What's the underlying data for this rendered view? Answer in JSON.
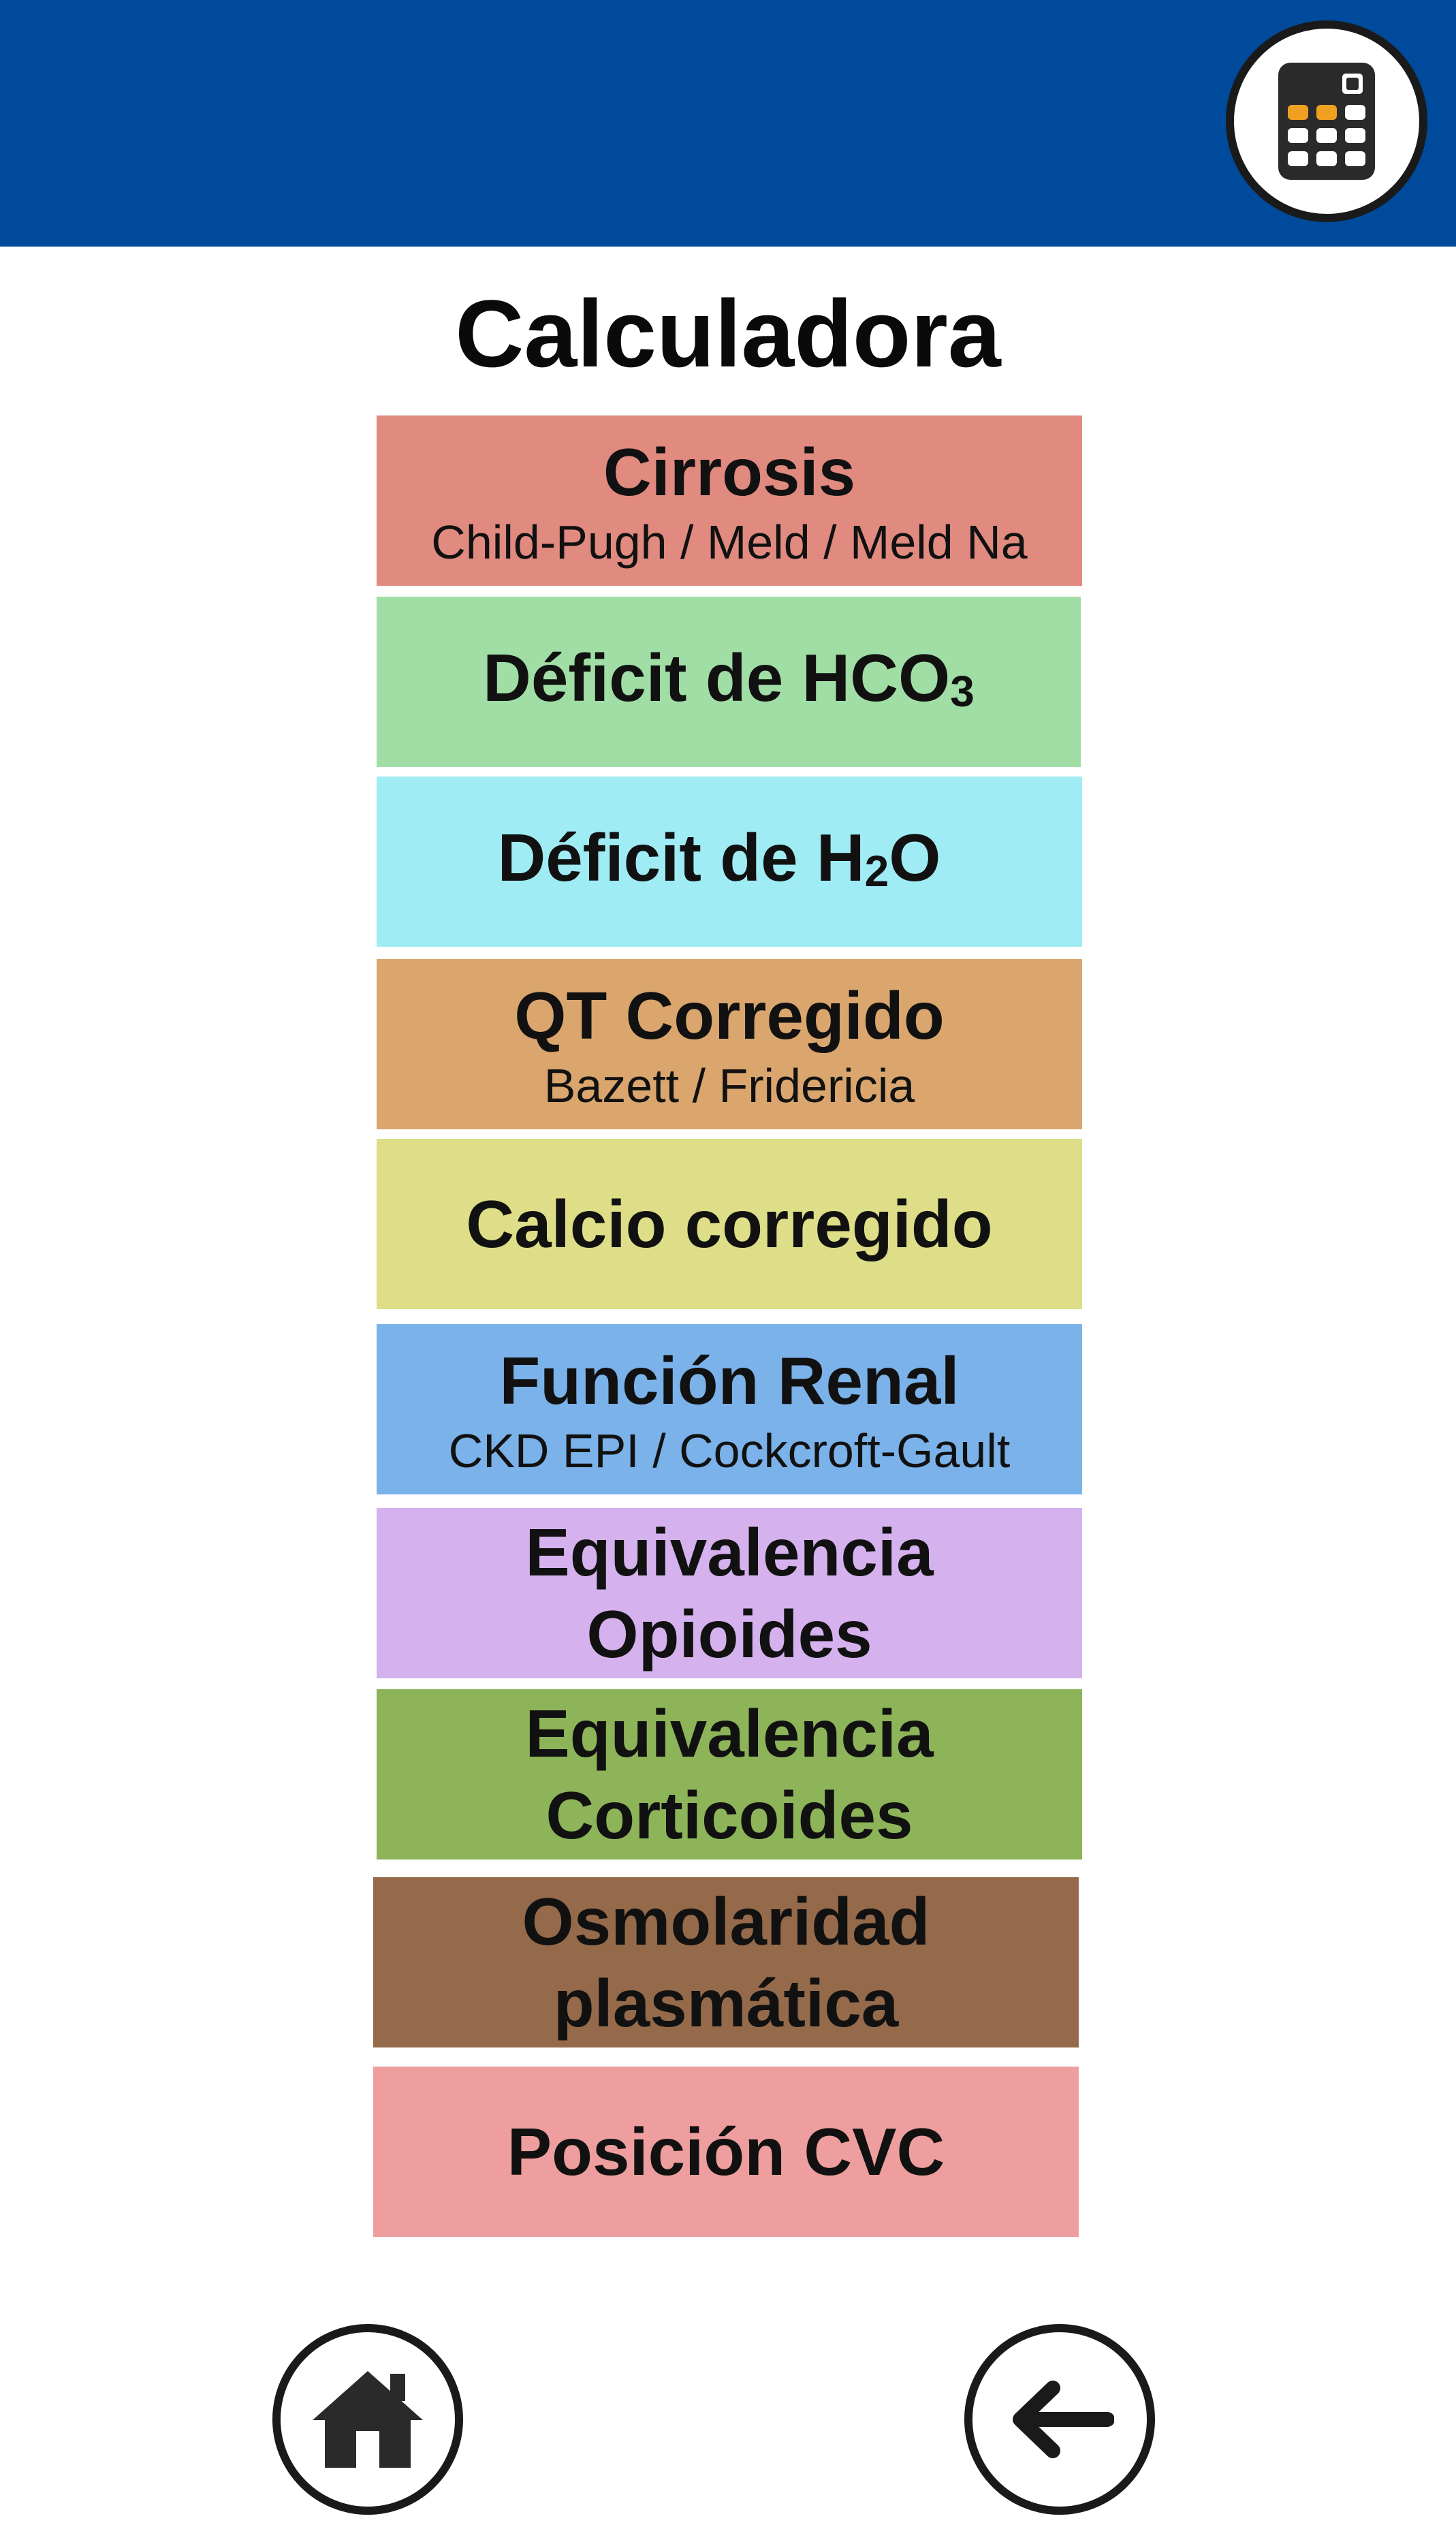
{
  "header": {
    "calculator_icon": "calculator-icon",
    "bar_color": "#004a9b"
  },
  "page": {
    "title": "Calculadora"
  },
  "menu": [
    {
      "title": "Cirrosis",
      "subtitle": "Child-Pugh / Meld / Meld Na",
      "color": "#e08a80"
    },
    {
      "title_prefix": "Déficit de HCO",
      "title_sub": "3",
      "title_suffix": "",
      "color": "#a0dea5"
    },
    {
      "title_prefix": "Déficit de H",
      "title_sub": "2",
      "title_suffix": "O",
      "color": "#a0ecf4"
    },
    {
      "title": "QT Corregido",
      "subtitle": "Bazett / Fridericia",
      "color": "#daa66e"
    },
    {
      "title": "Calcio corregido",
      "color": "#dede88"
    },
    {
      "title": "Función Renal",
      "subtitle": "CKD EPI / Cockcroft-Gault",
      "color": "#7ab2e9"
    },
    {
      "title_line1": "Equivalencia",
      "title_line2": "Opioides",
      "color": "#d5b1ed"
    },
    {
      "title_line1": "Equivalencia",
      "title_line2": "Corticoides",
      "color": "#8db458"
    },
    {
      "title_line1": "Osmolaridad",
      "title_line2": "plasmática",
      "color": "#946a4a"
    },
    {
      "title": "Posición CVC",
      "color": "#ee9e9e"
    }
  ],
  "footer": {
    "home_icon": "home-icon",
    "back_icon": "back-arrow-icon"
  }
}
